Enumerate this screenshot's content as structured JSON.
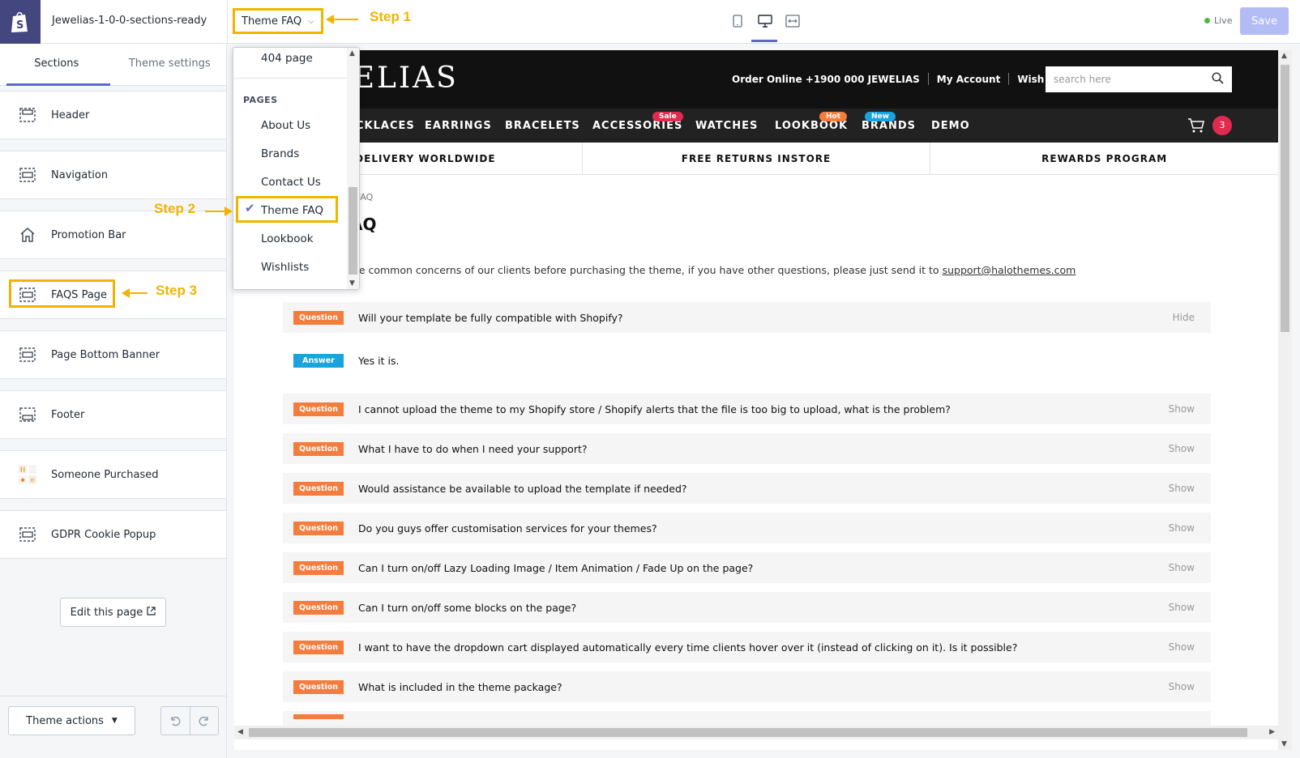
{
  "app": {
    "theme_name": "Jewelias-1-0-0-sections-ready"
  },
  "topbar": {
    "page_select": "Theme FAQ",
    "live_label": "Live",
    "save_label": "Save",
    "step1": "Step 1",
    "step2": "Step 2",
    "step3": "Step 3"
  },
  "sidebar": {
    "tabs": [
      "Sections",
      "Theme settings"
    ],
    "sections": [
      {
        "label": "Header",
        "icon": "layout-icon"
      },
      {
        "label": "Navigation",
        "icon": "layout-icon"
      },
      {
        "label": "Promotion Bar",
        "icon": "home-icon"
      },
      {
        "label": "FAQS Page",
        "icon": "layout-icon"
      },
      {
        "label": "Page Bottom Banner",
        "icon": "layout-icon"
      },
      {
        "label": "Footer",
        "icon": "layout-icon"
      },
      {
        "label": "Someone Purchased",
        "icon": "thumbnail-icon"
      },
      {
        "label": "GDPR Cookie Popup",
        "icon": "layout-icon"
      }
    ],
    "edit_page": "Edit this page",
    "theme_actions": "Theme actions"
  },
  "dropdown": {
    "top_item": "404 page",
    "group_label": "PAGES",
    "items": [
      "About Us",
      "Brands",
      "Contact Us",
      "Theme FAQ",
      "Lookbook",
      "Wishlists"
    ],
    "selected": "Theme FAQ"
  },
  "store": {
    "logo": "JEWELIAS",
    "links": [
      "Order Online +1900 000 JEWELIAS",
      "My Account",
      "Wish Lists"
    ],
    "search_placeholder": "search here",
    "nav": [
      {
        "label": "CKLACES"
      },
      {
        "label": "EARRINGS"
      },
      {
        "label": "BRACELETS"
      },
      {
        "label": "ACCESSORIES",
        "badge": "Sale",
        "badge_color": "#e02b4f"
      },
      {
        "label": "WATCHES"
      },
      {
        "label": "LOOKBOOK",
        "badge": "Hot",
        "badge_color": "#f47c3c"
      },
      {
        "label": "BRANDS",
        "badge": "New",
        "badge_color": "#1ba3dd"
      },
      {
        "label": "DEMO"
      }
    ],
    "cart_count": "3",
    "promo": [
      "FREE DELIVERY WORLDWIDE",
      "FREE RETURNS INSTORE",
      "REWARDS PROGRAM"
    ],
    "breadcrumb": "FAQ",
    "title": "AQ",
    "intro": "ome common concerns of our clients before purchasing the theme, if you have other questions, please just send it to",
    "intro_link": "support@halothemes.com",
    "question_tag": "Question",
    "answer_tag": "Answer",
    "faqs": [
      {
        "q": "Will your template be fully compatible with Shopify?",
        "action": "Hide",
        "a": "Yes it is."
      },
      {
        "q": "I cannot upload the theme to my Shopify store / Shopify alerts that the file is too big to upload, what is the problem?",
        "action": "Show"
      },
      {
        "q": "What I have to do when I need your support?",
        "action": "Show"
      },
      {
        "q": "Would assistance be available to upload the template if needed?",
        "action": "Show"
      },
      {
        "q": "Do you guys offer customisation services for your themes?",
        "action": "Show"
      },
      {
        "q": "Can I turn on/off Lazy Loading Image / Item Animation / Fade Up on the page?",
        "action": "Show"
      },
      {
        "q": "Can I turn on/off some blocks on the page?",
        "action": "Show"
      },
      {
        "q": "I want to have the dropdown cart displayed automatically every time clients hover over it (instead of clicking on it). Is it possible?",
        "action": "Show"
      },
      {
        "q": "What is included in the theme package?",
        "action": "Show"
      }
    ]
  },
  "colors": {
    "accent": "#5c6ac4",
    "annotation": "#f0b400",
    "question_tag": "#f47c3c",
    "answer_tag": "#1ba3dd"
  }
}
